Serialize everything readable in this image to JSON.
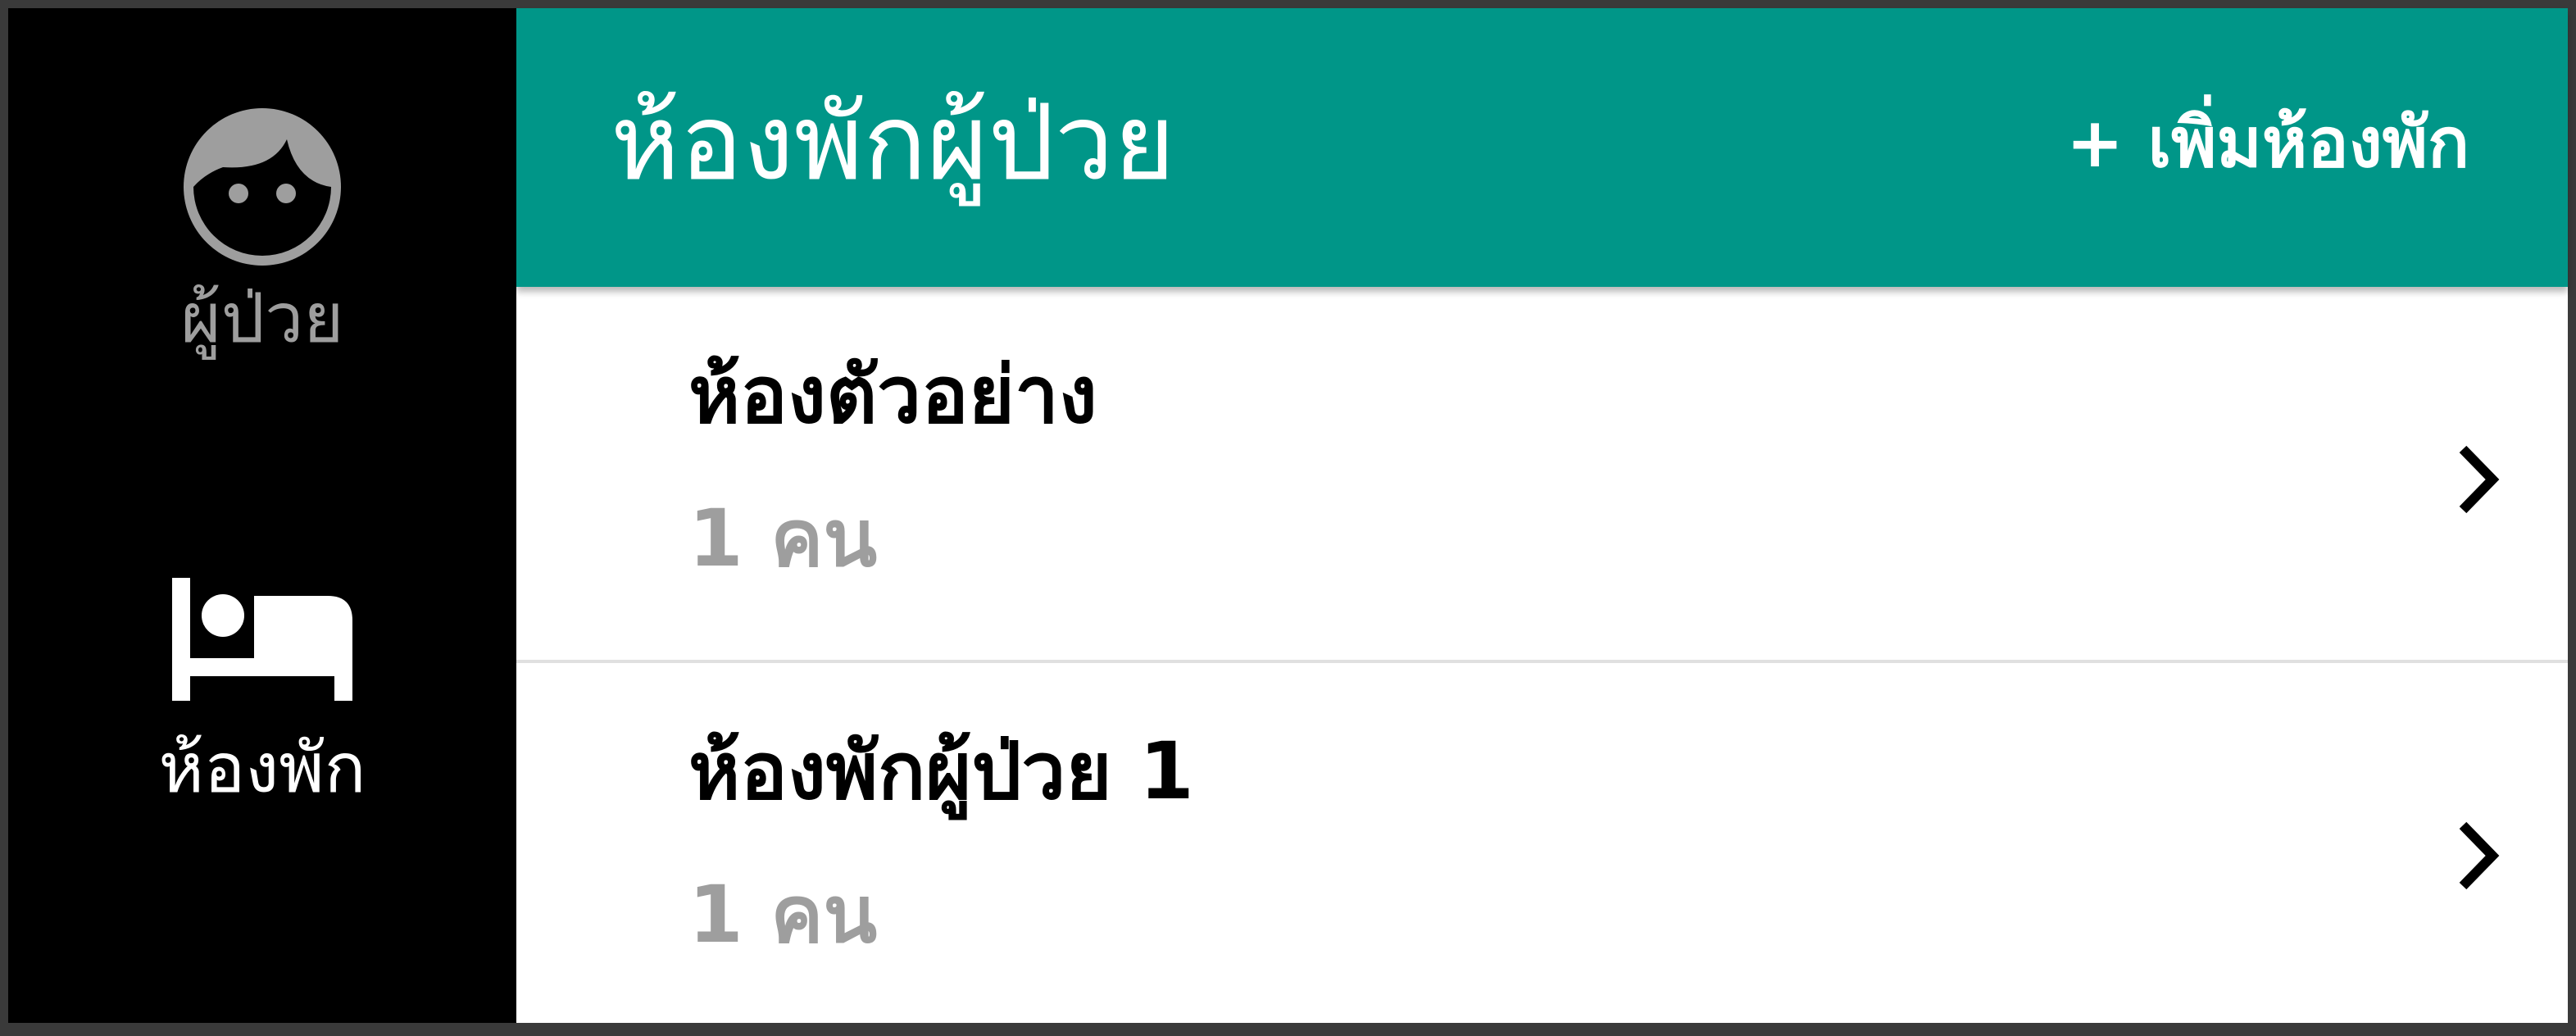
{
  "sidebar": {
    "items": [
      {
        "label": "ผู้ป่วย",
        "icon": "face-icon",
        "active": false,
        "color": "#9e9e9e"
      },
      {
        "label": "ห้องพัก",
        "icon": "bed-icon",
        "active": true,
        "color": "#ffffff"
      }
    ]
  },
  "header": {
    "title": "ห้องพักผู้ป่วย",
    "add_button_label": "+ เพิ่มห้องพัก",
    "background_color": "#009688"
  },
  "rooms": [
    {
      "name": "ห้องตัวอย่าง",
      "count": "1 คน"
    },
    {
      "name": "ห้องพักผู้ป่วย 1",
      "count": "1 คน"
    }
  ]
}
